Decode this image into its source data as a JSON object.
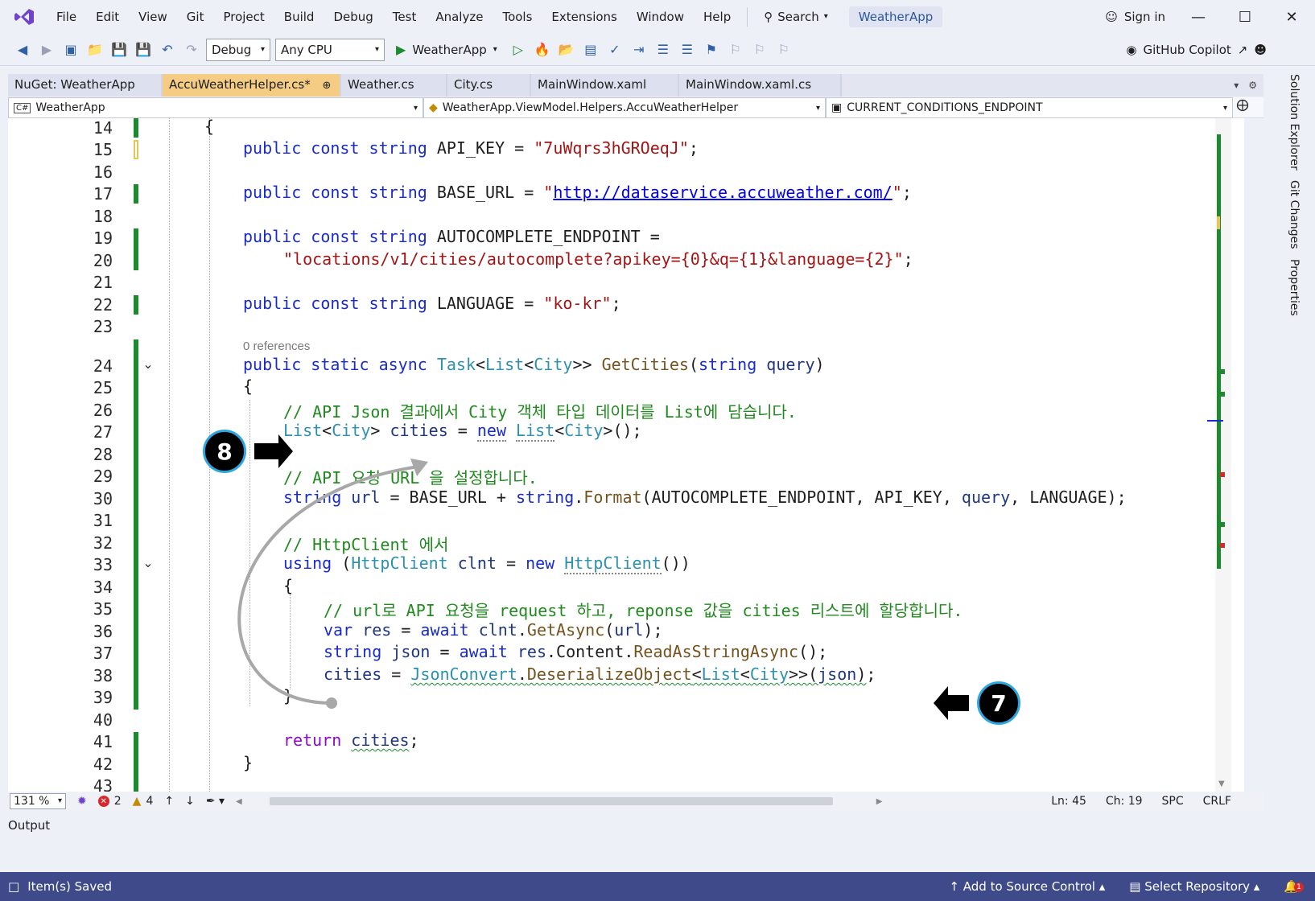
{
  "menu": [
    "File",
    "Edit",
    "View",
    "Git",
    "Project",
    "Build",
    "Debug",
    "Test",
    "Analyze",
    "Tools",
    "Extensions",
    "Window",
    "Help"
  ],
  "search_label": "Search",
  "solution_title": "WeatherApp",
  "signin_label": "Sign in",
  "toolbar": {
    "config": "Debug",
    "platform": "Any CPU",
    "run_target": "WeatherApp",
    "copilot": "GitHub Copilot"
  },
  "tabs": [
    {
      "label": "NuGet: WeatherApp",
      "active": false
    },
    {
      "label": "AccuWeatherHelper.cs*",
      "active": true
    },
    {
      "label": "Weather.cs",
      "active": false
    },
    {
      "label": "City.cs",
      "active": false
    },
    {
      "label": "MainWindow.xaml",
      "active": false
    },
    {
      "label": "MainWindow.xaml.cs",
      "active": false
    }
  ],
  "nav": {
    "project": "WeatherApp",
    "type": "WeatherApp.ViewModel.Helpers.AccuWeatherHelper",
    "member": "CURRENT_CONDITIONS_ENDPOINT"
  },
  "side_tabs": [
    "Solution Explorer",
    "Git Changes",
    "Properties"
  ],
  "line_numbers": [
    "14",
    "15",
    "16",
    "17",
    "18",
    "19",
    "20",
    "21",
    "22",
    "23",
    "24",
    "25",
    "26",
    "27",
    "28",
    "29",
    "30",
    "31",
    "32",
    "33",
    "34",
    "35",
    "36",
    "37",
    "38",
    "39",
    "40",
    "41",
    "42",
    "43"
  ],
  "code": {
    "l14": "{",
    "l15_kw": "public const string",
    "l15_name": " API_KEY = ",
    "l15_str": "\"7uWqrs3hGROeqJ\"",
    "l17_kw": "public const string",
    "l17_name": " BASE_URL = ",
    "l17_q1": "\"",
    "l17_url": "http://dataservice.accuweather.com/",
    "l17_q2": "\"",
    "l19_kw": "public const string",
    "l19_name": " AUTOCOMPLETE_ENDPOINT =",
    "l20_str": "\"locations/v1/cities/autocomplete?apikey={0}&q={1}&language={2}\"",
    "l22_kw": "public const string",
    "l22_name": " LANGUAGE = ",
    "l22_str": "\"ko-kr\"",
    "refs": "0 references",
    "l24_kw": "public static async",
    "l24_task": "Task",
    "l24_list": "List",
    "l24_city": "City",
    "l24_method": "GetCities",
    "l24_str": "string",
    "l24_param": "query",
    "l25": "{",
    "l26": "// API Json 결과에서 City 객체 타입 데이터를 List에 담습니다.",
    "l27_list": "List",
    "l27_city": "City",
    "l27_var": "cities",
    "l27_new": "new",
    "l27_list2": "List",
    "l27_city2": "City",
    "l29": "// API 요청 URL 을 설정합니다.",
    "l30_str": "string",
    "l30_url": "url",
    "l30_base": "BASE_URL",
    "l30_str2": "string",
    "l30_fmt": "Format",
    "l30_args1": "AUTOCOMPLETE_ENDPOINT, API_KEY, ",
    "l30_query": "query",
    "l30_args2": ", LANGUAGE);",
    "l32": "// HttpClient 에서",
    "l33_using": "using",
    "l33_type": "HttpClient",
    "l33_var": "clnt",
    "l33_new": "new",
    "l33_type2": "HttpClient",
    "l34": "{",
    "l35": "// url로 API 요청을 request 하고, reponse 값을 cities 리스트에 할당합니다.",
    "l36_var": "var",
    "l36_res": "res",
    "l36_await": "await",
    "l36_clnt": "clnt",
    "l36_get": "GetAsync",
    "l36_url": "url",
    "l37_str": "string",
    "l37_json": "json",
    "l37_await": "await",
    "l37_res": "res",
    "l37_content": "Content",
    "l37_read": "ReadAsStringAsync",
    "l38_cities": "cities",
    "l38_jc": "JsonConvert",
    "l38_deser": "DeserializeObject",
    "l38_list": "List",
    "l38_city": "City",
    "l38_json": "json",
    "l39": "}",
    "l41_ret": "return",
    "l41_cities": "cities",
    "l42": "}"
  },
  "annotations": {
    "a7": "7",
    "a8": "8"
  },
  "status": {
    "zoom": "131 %",
    "errors": "2",
    "warnings": "4",
    "line": "Ln: 45",
    "col": "Ch: 19",
    "spc": "SPC",
    "eol": "CRLF"
  },
  "output_label": "Output",
  "statusbar": {
    "saved": "Item(s) Saved",
    "source_control": "Add to Source Control",
    "repo": "Select Repository",
    "notif_count": "1"
  },
  "colors": {
    "active_tab": "#f5cc84",
    "status_bar": "#3e4a8a",
    "keyword": "#1a2cc8",
    "type": "#2b91af",
    "string": "#a31515",
    "comment": "#218a1f",
    "change_marker": "#1e8a2f"
  }
}
